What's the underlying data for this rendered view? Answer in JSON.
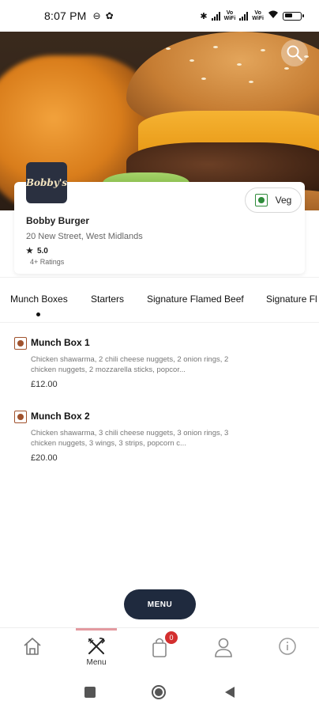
{
  "status_bar": {
    "time": "8:07 PM",
    "network_label_1": "Vo\nWiFi",
    "network_label_2": "Vo\nWiFi"
  },
  "restaurant": {
    "logo_text": "Bobby's",
    "name": "Bobby Burger",
    "address": "20 New Street, West Midlands",
    "rating": "5.0",
    "rating_count": "4+ Ratings",
    "veg_filter_label": "Veg"
  },
  "tabs": [
    {
      "label": "Munch Boxes",
      "active": true
    },
    {
      "label": "Starters",
      "active": false
    },
    {
      "label": "Signature Flamed Beef",
      "active": false
    },
    {
      "label": "Signature Fl",
      "active": false
    }
  ],
  "items": [
    {
      "name": "Munch Box 1",
      "description": "Chicken shawarma, 2 chili cheese nuggets, 2 onion rings, 2 chicken nuggets, 2 mozzarella sticks, popcor...",
      "price": "£12.00",
      "type": "non-veg"
    },
    {
      "name": "Munch Box 2",
      "description": "Chicken shawarma, 3 chili cheese nuggets, 3 onion rings, 3 chicken nuggets, 3 wings, 3 strips, popcorn c...",
      "price": "£20.00",
      "type": "non-veg"
    }
  ],
  "menu_button": {
    "label": "MENU"
  },
  "bottom_nav": {
    "active_label": "Menu",
    "cart_count": "0",
    "items": [
      "home-icon",
      "menu-icon",
      "cart-icon",
      "profile-icon",
      "info-icon"
    ]
  },
  "colors": {
    "accent": "#1f2a3e",
    "veg_green": "#2e8b3a",
    "nonveg_brown": "#a0522d",
    "badge_red": "#d32f2f",
    "active_bar": "#e39aa0"
  }
}
